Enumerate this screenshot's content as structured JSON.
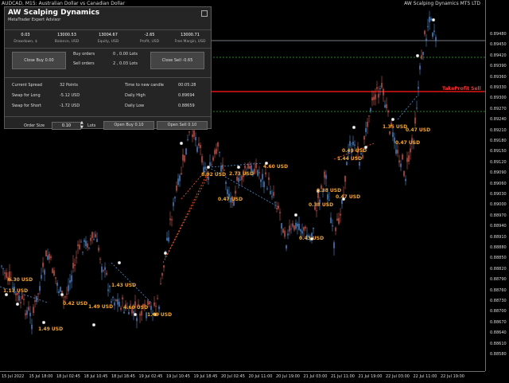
{
  "window": {
    "title": "AUDCAD, M15:  Australian Dollar vs Canadian Dollar",
    "ea_label": "AW Scalping Dynamics MT5 LTD"
  },
  "panel": {
    "title": "AW Scalping Dynamics",
    "subtitle": "MetaTrader Expert Advisor",
    "stats": [
      {
        "value": "0.03",
        "label": "Drawdown, $"
      },
      {
        "value": "13000.53",
        "label": "Balance, USD"
      },
      {
        "value": "13004.67",
        "label": "Equity, USD"
      },
      {
        "value": "-2.65",
        "label": "Profit, USD"
      },
      {
        "value": "13000.71",
        "label": "Free Margin, USD"
      }
    ],
    "close_buy": "Close Buy 0.00",
    "close_sell": "Close Sell -0.65",
    "buy_orders_label": "Buy orders",
    "buy_orders_value": "0  , 0.00 Lots",
    "sell_orders_label": "Sell orders",
    "sell_orders_value": "2  , 0.03 Lots",
    "info": [
      {
        "label": "Current Spread",
        "value": "32 Points",
        "label2": "Time to new candle",
        "value2": "00:05:28"
      },
      {
        "label": "Swap for Long",
        "value": "-5.12 USD",
        "label2": "Daily High",
        "value2": "0.89694"
      },
      {
        "label": "Swap for Short",
        "value": "-1.72 USD",
        "label2": "Daily Low",
        "value2": "0.88659"
      }
    ],
    "order_size_label": "Order Size",
    "order_size_value": "0.10",
    "lots_label": "Lots",
    "open_buy": "Open Buy 0.10",
    "open_sell": "Open Sell 0.10"
  },
  "chart_data": {
    "type": "candlestick",
    "symbol": "AUDCAD",
    "timeframe": "M15",
    "yticks": [
      "0.89480",
      "0.89450",
      "0.89420",
      "0.89390",
      "0.89360",
      "0.89330",
      "0.89300",
      "0.89270",
      "0.89240",
      "0.89210",
      "0.89180",
      "0.89150",
      "0.89120",
      "0.89090",
      "0.89060",
      "0.89030",
      "0.89000",
      "0.88970",
      "0.88940",
      "0.88910",
      "0.88880",
      "0.88850",
      "0.88820",
      "0.88790",
      "0.88760",
      "0.88730",
      "0.88700",
      "0.88670",
      "0.88640",
      "0.88610",
      "0.88580"
    ],
    "xticks": [
      "15 Jul 2022",
      "15 Jul 18:00",
      "18 Jul 02:45",
      "18 Jul 10:45",
      "18 Jul 18:45",
      "19 Jul 02:45",
      "19 Jul 10:45",
      "19 Jul 18:45",
      "20 Jul 02:45",
      "20 Jul 11:00",
      "20 Jul 19:00",
      "21 Jul 03:00",
      "21 Jul 11:00",
      "21 Jul 19:00",
      "22 Jul 03:00",
      "22 Jul 11:00",
      "22 Jul 19:00"
    ],
    "take_profit_label": "TakeProfit Sell",
    "profit_labels": [
      {
        "text": "1.17 USD",
        "x": 4,
        "y": 362
      },
      {
        "text": "6.30 USD",
        "x": 10,
        "y": 348
      },
      {
        "text": "1.49 USD",
        "x": 48,
        "y": 410
      },
      {
        "text": "0.42 USD",
        "x": 79,
        "y": 378
      },
      {
        "text": "1.43 USD",
        "x": 140,
        "y": 355
      },
      {
        "text": "1.49 USD",
        "x": 111,
        "y": 382
      },
      {
        "text": "4.60 USD",
        "x": 155,
        "y": 383
      },
      {
        "text": "1.49 USD",
        "x": 185,
        "y": 392
      },
      {
        "text": "8.92 USD",
        "x": 253,
        "y": 216
      },
      {
        "text": "2.73 USD",
        "x": 288,
        "y": 215
      },
      {
        "text": "4.60 USD",
        "x": 331,
        "y": 206
      },
      {
        "text": "0.47 USD",
        "x": 274,
        "y": 247
      },
      {
        "text": "0.38 USD",
        "x": 398,
        "y": 236
      },
      {
        "text": "0.47 USD",
        "x": 422,
        "y": 244
      },
      {
        "text": "0.38 USD",
        "x": 388,
        "y": 254
      },
      {
        "text": "0.43 USD",
        "x": 376,
        "y": 296
      },
      {
        "text": "0.49 USD",
        "x": 430,
        "y": 186
      },
      {
        "text": "1.44 USD",
        "x": 424,
        "y": 196
      },
      {
        "text": "1.35 USD",
        "x": 481,
        "y": 156
      },
      {
        "text": "0.47 USD",
        "x": 510,
        "y": 160
      },
      {
        "text": "0.47 USD",
        "x": 497,
        "y": 176
      }
    ]
  }
}
